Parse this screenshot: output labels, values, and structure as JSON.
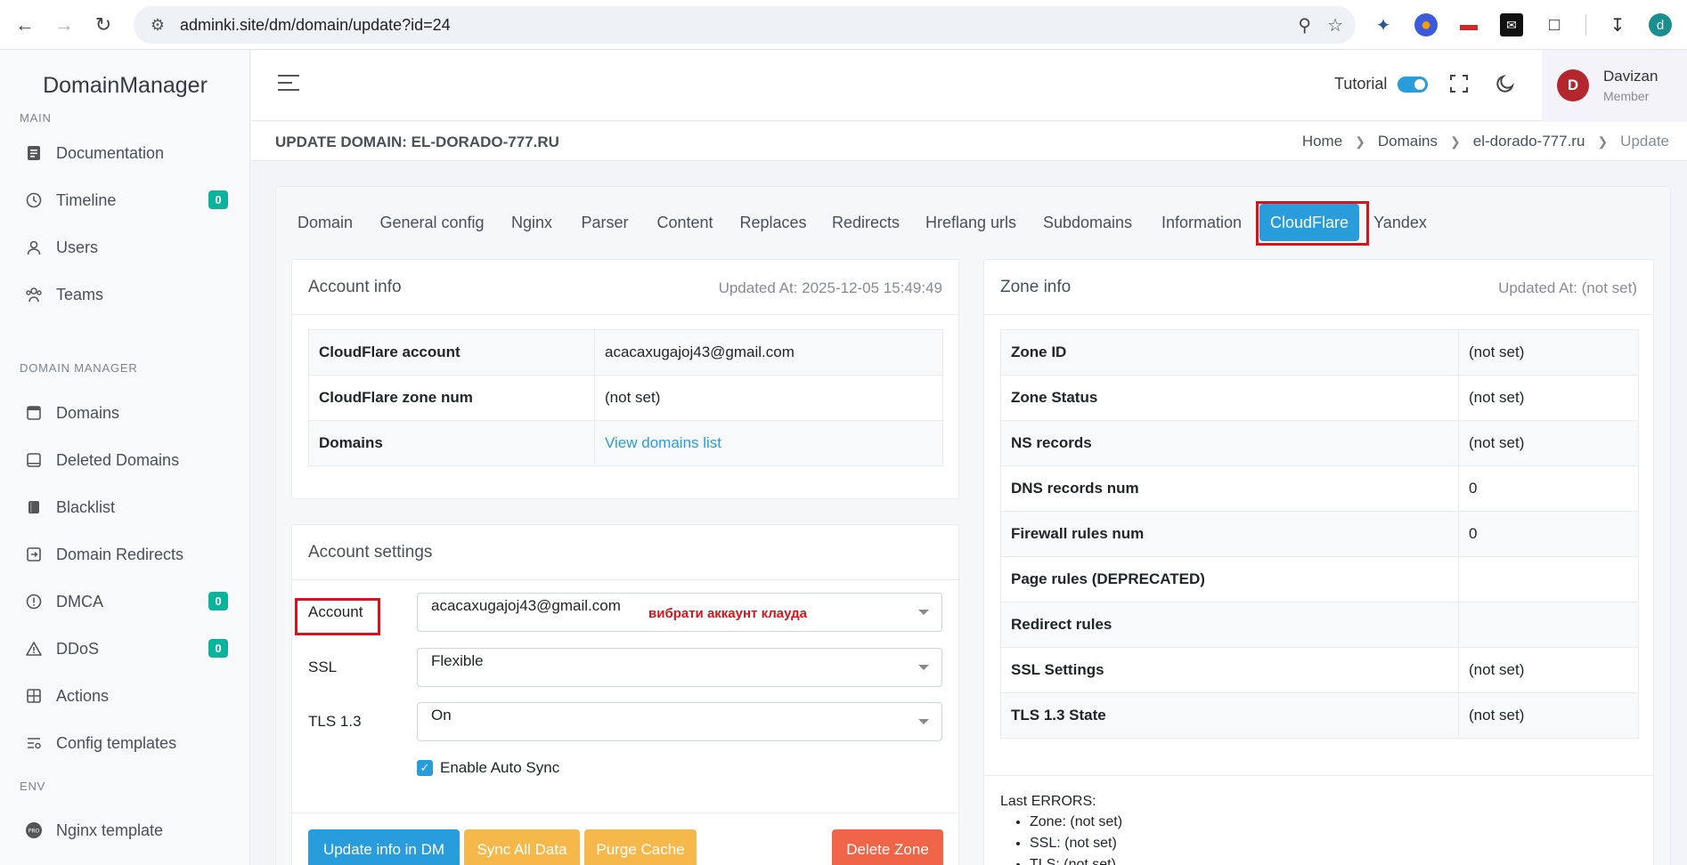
{
  "browser": {
    "url": "adminki.site/dm/domain/update?id=24",
    "profile_letter": "d"
  },
  "sidebar": {
    "brand": "DomainManager",
    "sections": {
      "main": "MAIN",
      "domain_manager": "DOMAIN MANAGER",
      "env": "ENV"
    },
    "items": [
      {
        "label": "Documentation"
      },
      {
        "label": "Timeline",
        "badge": "0"
      },
      {
        "label": "Users"
      },
      {
        "label": "Teams"
      },
      {
        "label": "Domains"
      },
      {
        "label": "Deleted Domains"
      },
      {
        "label": "Blacklist"
      },
      {
        "label": "Domain Redirects"
      },
      {
        "label": "DMCA",
        "badge": "0"
      },
      {
        "label": "DDoS",
        "badge": "0"
      },
      {
        "label": "Actions"
      },
      {
        "label": "Config templates"
      },
      {
        "label": "Nginx template"
      }
    ]
  },
  "topbar": {
    "tutorial_label": "Tutorial",
    "user_initial": "D",
    "user_name": "Davizan",
    "user_role": "Member"
  },
  "page": {
    "title": "UPDATE DOMAIN: EL-DORADO-777.RU",
    "breadcrumb": [
      "Home",
      "Domains",
      "el-dorado-777.ru",
      "Update"
    ]
  },
  "tabs": [
    "Domain",
    "General config",
    "Nginx",
    "Parser",
    "Content",
    "Replaces",
    "Redirects",
    "Hreflang urls",
    "Subdomains",
    "Information",
    "CloudFlare",
    "Yandex"
  ],
  "account_info": {
    "title": "Account info",
    "updated": "Updated At: 2025-12-05 15:49:49",
    "rows": [
      {
        "label": "CloudFlare account",
        "value": "acacaxugajoj43@gmail.com"
      },
      {
        "label": "CloudFlare zone num",
        "value": "(not set)"
      },
      {
        "label": "Domains",
        "value": "View domains list"
      }
    ]
  },
  "account_settings": {
    "title": "Account settings",
    "account_label": "Account",
    "account_value": "acacaxugajoj43@gmail.com",
    "annotation": "вибрати аккаунт клауда",
    "ssl_label": "SSL",
    "ssl_value": "Flexible",
    "tls_label": "TLS 1.3",
    "tls_value": "On",
    "auto_sync_label": "Enable Auto Sync"
  },
  "buttons": {
    "update": "Update info in DM",
    "sync": "Sync All Data",
    "purge": "Purge Cache",
    "delete": "Delete Zone"
  },
  "zone_info": {
    "title": "Zone info",
    "updated": "Updated At: (not set)",
    "rows": [
      {
        "label": "Zone ID",
        "value": "(not set)"
      },
      {
        "label": "Zone Status",
        "value": "(not set)"
      },
      {
        "label": "NS records",
        "value": "(not set)"
      },
      {
        "label": "DNS records num",
        "value": "0"
      },
      {
        "label": "Firewall rules num",
        "value": "0"
      },
      {
        "label": "Page rules (DEPRECATED)",
        "value": ""
      },
      {
        "label": "Redirect rules",
        "value": ""
      },
      {
        "label": "SSL Settings",
        "value": "(not set)"
      },
      {
        "label": "TLS 1.3 State",
        "value": "(not set)"
      }
    ],
    "errors_title": "Last ERRORS:",
    "errors": [
      "Zone: (not set)",
      "SSL: (not set)",
      "TLS: (not set)"
    ]
  },
  "colors": {
    "primary": "#299cdb",
    "success_badge": "#0ab39c",
    "warning": "#f7b84b",
    "danger": "#f06548",
    "highlight_box": "#d5151b"
  }
}
